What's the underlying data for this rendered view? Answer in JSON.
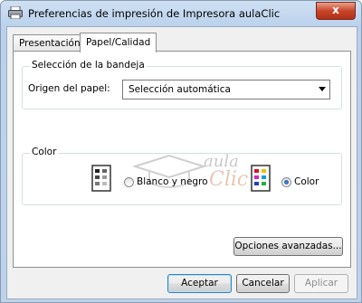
{
  "window": {
    "title": "Preferencias de impresión de Impresora aulaClic",
    "close_glyph": "x"
  },
  "tabs": [
    {
      "label": "Presentación",
      "active": false
    },
    {
      "label": "Papel/Calidad",
      "active": true
    }
  ],
  "tray_group": {
    "legend": "Selección de la bandeja",
    "source_label": "Origen del papel:",
    "source_value": "Selección automática"
  },
  "color_group": {
    "legend": "Color",
    "options": [
      {
        "label": "Blanco y negro",
        "checked": false,
        "icon": "grayscale-printer-icon"
      },
      {
        "label": "Color",
        "checked": true,
        "icon": "color-printer-icon"
      }
    ]
  },
  "watermark": {
    "text_top": "aula",
    "text_bottom": "Clic"
  },
  "advanced_button": "Opciones avanzadas...",
  "dialog_buttons": {
    "ok": "Aceptar",
    "cancel": "Cancelar",
    "apply": "Aplicar"
  },
  "colors": {
    "accent_blue": "#1c4f9e",
    "close_red": "#c7462a",
    "window_frame": "#bdd3ec"
  }
}
